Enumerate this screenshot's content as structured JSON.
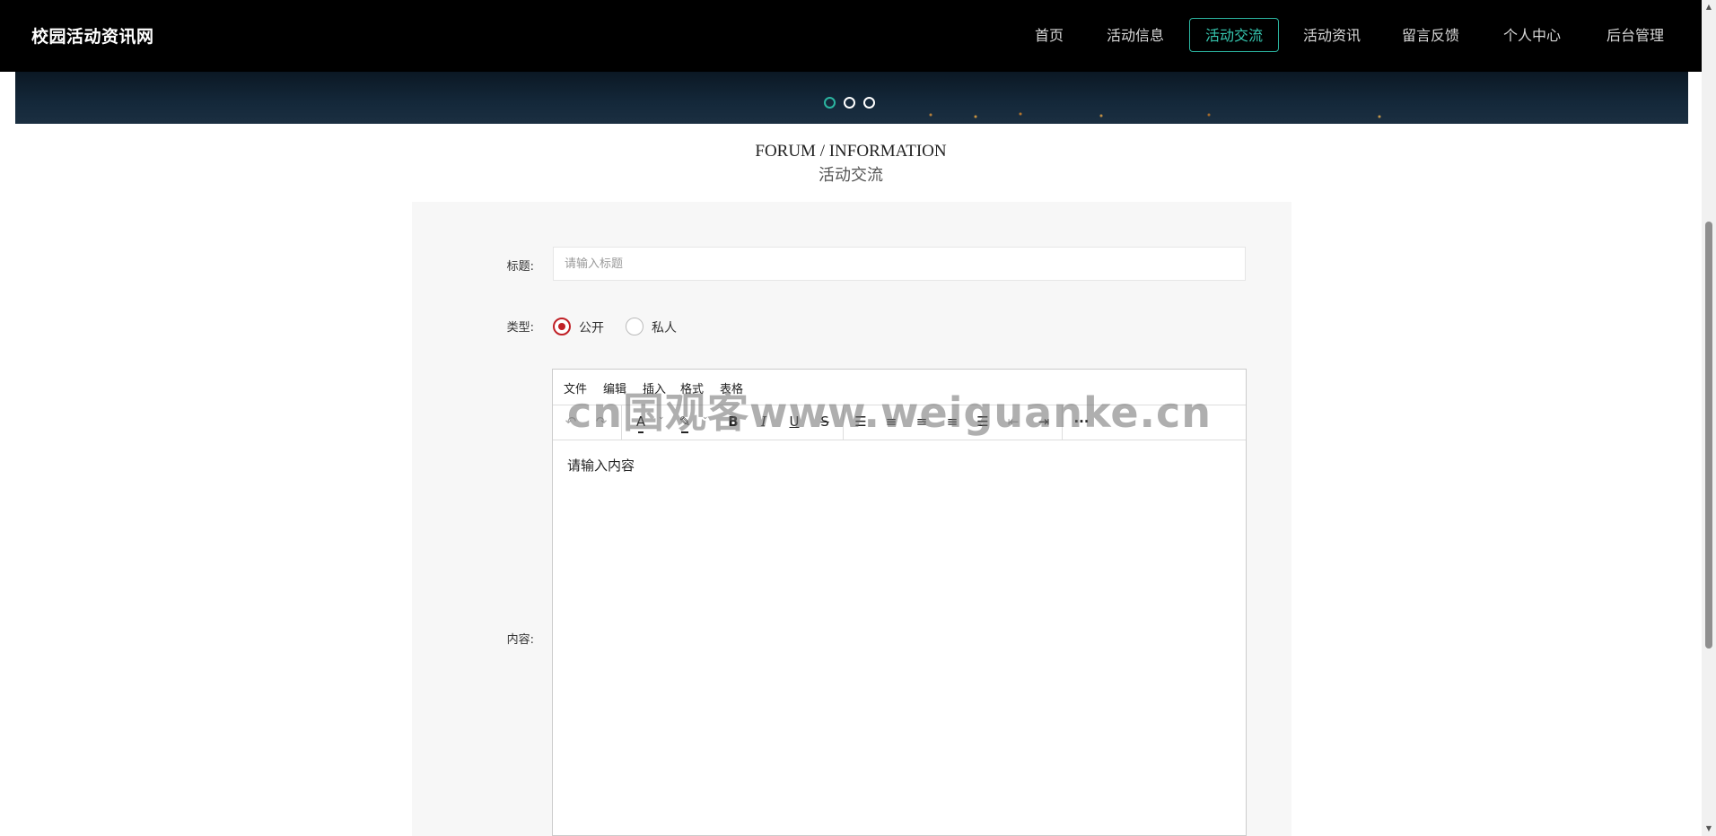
{
  "header": {
    "site_title": "校园活动资讯网",
    "nav": [
      {
        "label": "首页"
      },
      {
        "label": "活动信息"
      },
      {
        "label": "活动交流",
        "active": true
      },
      {
        "label": "活动资讯"
      },
      {
        "label": "留言反馈"
      },
      {
        "label": "个人中心"
      },
      {
        "label": "后台管理"
      }
    ],
    "accent_color": "#2bb5a0"
  },
  "carousel": {
    "slides": 3,
    "active_index": 0
  },
  "section": {
    "title_en": "FORUM / INFORMATION",
    "title_cn": "活动交流"
  },
  "form": {
    "title_label": "标题:",
    "title_placeholder": "请输入标题",
    "title_value": "",
    "type_label": "类型:",
    "type_options": [
      {
        "label": "公开",
        "checked": true
      },
      {
        "label": "私人",
        "checked": false
      }
    ],
    "content_label": "内容:"
  },
  "editor": {
    "menu": [
      "文件",
      "编辑",
      "插入",
      "格式",
      "表格"
    ],
    "toolbar_icons": [
      "undo-icon",
      "redo-icon",
      "text-color-icon",
      "highlight-color-icon",
      "bold-icon",
      "italic-icon",
      "underline-icon",
      "strikethrough-icon",
      "line-height-icon",
      "align-left-icon",
      "align-center-icon",
      "align-right-icon",
      "align-justify-icon",
      "outdent-icon",
      "indent-icon",
      "more-icon"
    ],
    "content": "请输入内容"
  },
  "watermark": "cn国观客www.weiguanke.cn",
  "colors": {
    "radio_checked": "#c02026",
    "panel_bg": "#f7f7f7"
  }
}
